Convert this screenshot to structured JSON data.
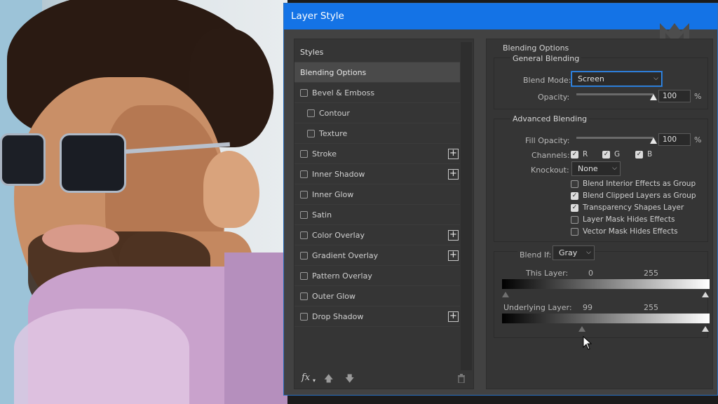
{
  "dialog": {
    "title": "Layer Style"
  },
  "styles_panel": {
    "header": "Styles",
    "items": [
      {
        "label": "Blending Options",
        "checkbox": false,
        "selected": true,
        "plus": false,
        "indent": false
      },
      {
        "label": "Bevel & Emboss",
        "checkbox": true,
        "checked": false,
        "plus": false,
        "indent": false
      },
      {
        "label": "Contour",
        "checkbox": true,
        "checked": false,
        "plus": false,
        "indent": true
      },
      {
        "label": "Texture",
        "checkbox": true,
        "checked": false,
        "plus": false,
        "indent": true
      },
      {
        "label": "Stroke",
        "checkbox": true,
        "checked": false,
        "plus": true,
        "indent": false
      },
      {
        "label": "Inner Shadow",
        "checkbox": true,
        "checked": false,
        "plus": true,
        "indent": false
      },
      {
        "label": "Inner Glow",
        "checkbox": true,
        "checked": false,
        "plus": false,
        "indent": false
      },
      {
        "label": "Satin",
        "checkbox": true,
        "checked": false,
        "plus": false,
        "indent": false
      },
      {
        "label": "Color Overlay",
        "checkbox": true,
        "checked": false,
        "plus": true,
        "indent": false
      },
      {
        "label": "Gradient Overlay",
        "checkbox": true,
        "checked": false,
        "plus": true,
        "indent": false
      },
      {
        "label": "Pattern Overlay",
        "checkbox": true,
        "checked": false,
        "plus": false,
        "indent": false
      },
      {
        "label": "Outer Glow",
        "checkbox": true,
        "checked": false,
        "plus": false,
        "indent": false
      },
      {
        "label": "Drop Shadow",
        "checkbox": true,
        "checked": false,
        "plus": true,
        "indent": false
      }
    ],
    "footer": {
      "fx": "fx",
      "plus_icon": "+"
    }
  },
  "blending_options": {
    "title": "Blending Options",
    "general": {
      "title": "General Blending",
      "blend_mode_label": "Blend Mode:",
      "blend_mode_value": "Screen",
      "opacity_label": "Opacity:",
      "opacity_value": "100",
      "opacity_level": 1.0,
      "percent": "%"
    },
    "advanced": {
      "title": "Advanced Blending",
      "fill_opacity_label": "Fill Opacity:",
      "fill_opacity_value": "100",
      "fill_opacity_level": 1.0,
      "percent": "%",
      "channels_label": "Channels:",
      "channel_r": "R",
      "channel_g": "G",
      "channel_b": "B",
      "knockout_label": "Knockout:",
      "knockout_value": "None",
      "options": [
        {
          "label": "Blend Interior Effects as Group",
          "checked": false
        },
        {
          "label": "Blend Clipped Layers as Group",
          "checked": true
        },
        {
          "label": "Transparency Shapes Layer",
          "checked": true
        },
        {
          "label": "Layer Mask Hides Effects",
          "checked": false
        },
        {
          "label": "Vector Mask Hides Effects",
          "checked": false
        }
      ]
    },
    "blend_if": {
      "label": "Blend If:",
      "value": "Gray",
      "this_layer_label": "This Layer:",
      "this_layer_low": "0",
      "this_layer_high": "255",
      "underlying_label": "Underlying Layer:",
      "underlying_low": "99",
      "underlying_high": "255"
    }
  },
  "colors": {
    "title_bar": "#1473e6",
    "dialog_bg": "#424242",
    "panel_bg": "#353535",
    "selected_row": "#4a4a4a"
  }
}
